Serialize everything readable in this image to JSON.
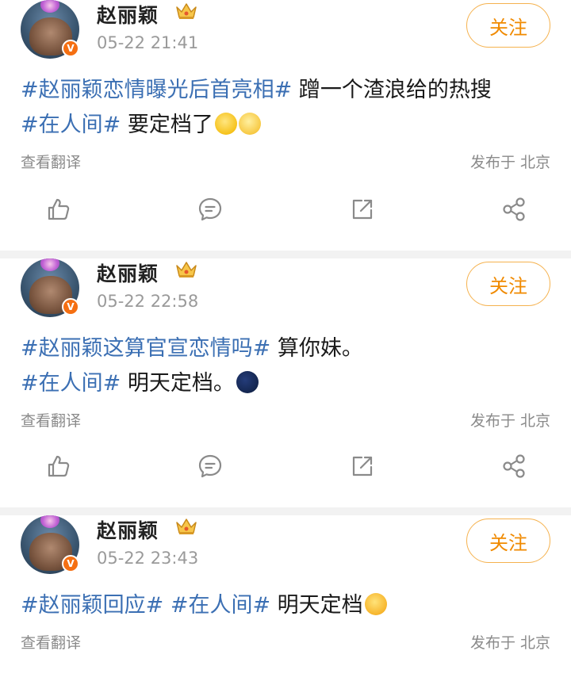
{
  "posts": [
    {
      "author": "赵丽颖",
      "verified_badge": "V",
      "time": "05-22 21:41",
      "follow_label": "关注",
      "segments_line1": [
        {
          "type": "tag",
          "text": "#赵丽颖恋情曝光后首亮相#"
        },
        {
          "type": "text",
          "text": " 蹭一个渣浪给的热搜"
        }
      ],
      "segments_line2": [
        {
          "type": "tag",
          "text": "#在人间#"
        },
        {
          "type": "text",
          "text": " 要定档了"
        }
      ],
      "emojis": [
        "kiss-emoji",
        "party-emoji"
      ],
      "translate_label": "查看翻译",
      "location": "发布于 北京"
    },
    {
      "author": "赵丽颖",
      "verified_badge": "V",
      "time": "05-22 22:58",
      "follow_label": "关注",
      "segments_line1": [
        {
          "type": "tag",
          "text": "#赵丽颖这算官宣恋情吗#"
        },
        {
          "type": "text",
          "text": " 算你妹。"
        }
      ],
      "segments_line2": [
        {
          "type": "tag",
          "text": "#在人间#"
        },
        {
          "type": "text",
          "text": " 明天定档。"
        }
      ],
      "emojis": [
        "moon-emoji"
      ],
      "translate_label": "查看翻译",
      "location": "发布于 北京"
    },
    {
      "author": "赵丽颖",
      "verified_badge": "V",
      "time": "05-22 23:43",
      "follow_label": "关注",
      "segments_line1": [
        {
          "type": "tag",
          "text": "#赵丽颖回应#"
        },
        {
          "type": "text",
          "text": " "
        },
        {
          "type": "tag",
          "text": "#在人间#"
        },
        {
          "type": "text",
          "text": " 明天定档"
        }
      ],
      "emojis": [
        "yawn-emoji"
      ],
      "translate_label": "查看翻译",
      "location": "发布于 北京"
    }
  ],
  "icons": {
    "like": "thumbs-up-icon",
    "comment": "comment-icon",
    "repost": "repost-icon",
    "share": "share-icon",
    "crown": "crown-icon"
  },
  "colors": {
    "hashtag": "#3b6fb3",
    "follow": "#f08a00",
    "follow_border": "#f5b24f",
    "verified": "#f56f12"
  }
}
